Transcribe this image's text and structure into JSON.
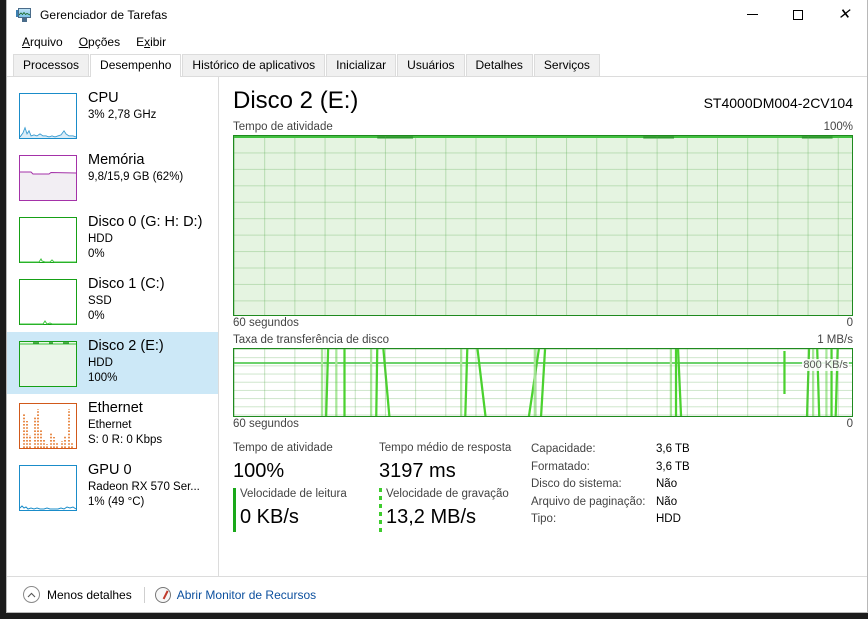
{
  "window": {
    "title": "Gerenciador de Tarefas",
    "icon": "task-manager-icon",
    "minimize": "—",
    "maximize": "□",
    "close": "✕"
  },
  "menu": [
    {
      "label": "Arquivo",
      "accel": "A"
    },
    {
      "label": "Opções",
      "accel": "O"
    },
    {
      "label": "Exibir",
      "accel": "x"
    }
  ],
  "tabs": [
    {
      "label": "Processos",
      "active": false
    },
    {
      "label": "Desempenho",
      "active": true
    },
    {
      "label": "Histórico de aplicativos",
      "active": false
    },
    {
      "label": "Inicializar",
      "active": false
    },
    {
      "label": "Usuários",
      "active": false
    },
    {
      "label": "Detalhes",
      "active": false
    },
    {
      "label": "Serviços",
      "active": false
    }
  ],
  "sidebar": [
    {
      "title": "CPU",
      "sub1": "3%  2,78 GHz",
      "sub2": "",
      "color": "#1a8cc9",
      "selected": false
    },
    {
      "title": "Memória",
      "sub1": "9,8/15,9 GB (62%)",
      "sub2": "",
      "color": "#a432a8",
      "selected": false
    },
    {
      "title": "Disco 0 (G: H: D:)",
      "sub1": "HDD",
      "sub2": "0%",
      "color": "#16a016",
      "selected": false
    },
    {
      "title": "Disco 1 (C:)",
      "sub1": "SSD",
      "sub2": "0%",
      "color": "#16a016",
      "selected": false
    },
    {
      "title": "Disco 2 (E:)",
      "sub1": "HDD",
      "sub2": "100%",
      "color": "#16a016",
      "selected": true
    },
    {
      "title": "Ethernet",
      "sub1": "Ethernet",
      "sub2": "S: 0 R: 0 Kbps",
      "color": "#d1591a",
      "selected": false
    },
    {
      "title": "GPU 0",
      "sub1": "Radeon RX 570 Ser...",
      "sub2": "1%  (49 °C)",
      "color": "#1a8cc9",
      "selected": false
    }
  ],
  "main": {
    "title": "Disco 2 (E:)",
    "model": "ST4000DM004-2CV104",
    "graph_top": {
      "label": "Tempo de atividade",
      "max": "100%",
      "x_left": "60 segundos",
      "x_right": "0"
    },
    "graph_bottom": {
      "label": "Taxa de transferência de disco",
      "max": "1 MB/s",
      "inline_marker": "800 KB/s",
      "x_left": "60 segundos",
      "x_right": "0"
    },
    "stats": [
      {
        "label": "Tempo de atividade",
        "value": "100%",
        "marker": "none"
      },
      {
        "label": "Tempo médio de resposta",
        "value": "3197 ms",
        "marker": "none"
      },
      {
        "label": "Velocidade de leitura",
        "value": "0 KB/s",
        "marker": "solid"
      },
      {
        "label": "Velocidade de gravação",
        "value": "13,2 MB/s",
        "marker": "dashed"
      }
    ],
    "details": [
      {
        "key": "Capacidade:",
        "value": "3,6 TB"
      },
      {
        "key": "Formatado:",
        "value": "3,6 TB"
      },
      {
        "key": "Disco do sistema:",
        "value": "Não"
      },
      {
        "key": "Arquivo de paginação:",
        "value": "Não"
      },
      {
        "key": "Tipo:",
        "value": "HDD"
      }
    ]
  },
  "footer": {
    "less_details": "Menos detalhes",
    "resource_monitor": "Abrir Monitor de Recursos",
    "chevron_icon": "chevron-up-icon",
    "resmon_icon": "resource-monitor-icon"
  },
  "colors": {
    "disk_line": "#1f8a1f",
    "disk_fill": "#eaf6e8",
    "spike": "#4ad32e",
    "selection": "#cce8f7",
    "link": "#0b4f9e"
  },
  "chart_data": [
    {
      "type": "area",
      "title": "Tempo de atividade",
      "ylabel": "% tempo de atividade",
      "xlabel": "60 segundos",
      "ylim": [
        0,
        100
      ],
      "x_axis_left": "60 segundos",
      "x_axis_right": "0",
      "grid": true,
      "legend": "none",
      "series": [
        {
          "name": "Tempo de atividade",
          "values": [
            100,
            100,
            100,
            100,
            100,
            100,
            100,
            100,
            100,
            100,
            100,
            100,
            100,
            100,
            100,
            100,
            100,
            100,
            100,
            100,
            100,
            100,
            100,
            100,
            100,
            100,
            100,
            100,
            100,
            100,
            100,
            100,
            100,
            100,
            100,
            100,
            100,
            100,
            100,
            100,
            100,
            100,
            100,
            100,
            100,
            100,
            100,
            100,
            100,
            100,
            100,
            100,
            100,
            100,
            100,
            100,
            100,
            100,
            100,
            100
          ]
        }
      ]
    },
    {
      "type": "line",
      "title": "Taxa de transferência de disco",
      "ylabel": "MB/s",
      "xlabel": "60 segundos",
      "ylim": [
        0,
        1
      ],
      "x_axis_left": "60 segundos",
      "x_axis_right": "0",
      "annotation": "800 KB/s",
      "grid": true,
      "legend": "none",
      "series": [
        {
          "name": "Taxa de transferência de disco",
          "values": [
            0.8,
            0.8,
            0.8,
            0.8,
            0.8,
            0.8,
            0.8,
            0.05,
            0.8,
            0.8,
            0.1,
            0.8,
            0.8,
            0.8,
            0.0,
            0.8,
            0.8,
            0.05,
            0.8,
            0.8,
            0.8,
            0.8,
            0.0,
            0.8,
            0.8,
            0.8,
            0.8,
            0.1,
            0.0,
            0.8,
            0.8,
            0.8,
            0.8,
            0.8,
            0.8,
            0.8,
            0.8,
            0.8,
            0.8,
            0.8,
            0.8,
            0.0,
            0.8,
            0.8,
            0.8,
            0.8,
            0.8,
            0.8,
            0.8,
            0.7,
            0.8,
            0.8,
            0.8,
            0.8,
            0.0,
            0.05,
            0.0,
            0.8,
            0.8,
            0.8
          ]
        }
      ]
    }
  ]
}
